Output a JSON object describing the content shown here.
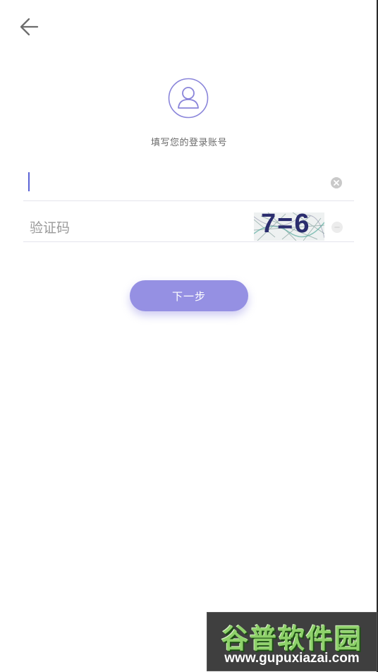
{
  "header": {
    "back_icon": "arrow-left-icon"
  },
  "profile": {
    "avatar_icon": "user-avatar-icon",
    "subtitle": "填写您的登录账号"
  },
  "form": {
    "account": {
      "value": "",
      "placeholder": "",
      "clear_icon": "clear-icon"
    },
    "captcha": {
      "placeholder": "验证码",
      "image_text": "7=6",
      "refresh_icon": "refresh-icon"
    }
  },
  "actions": {
    "next_label": "下一步"
  },
  "watermark": {
    "title": "谷普软件园",
    "url": "www.gupuxiazai.com"
  },
  "colors": {
    "accent": "#9590e3",
    "caret": "#5b63d6",
    "avatar_stroke": "#8a85da"
  }
}
